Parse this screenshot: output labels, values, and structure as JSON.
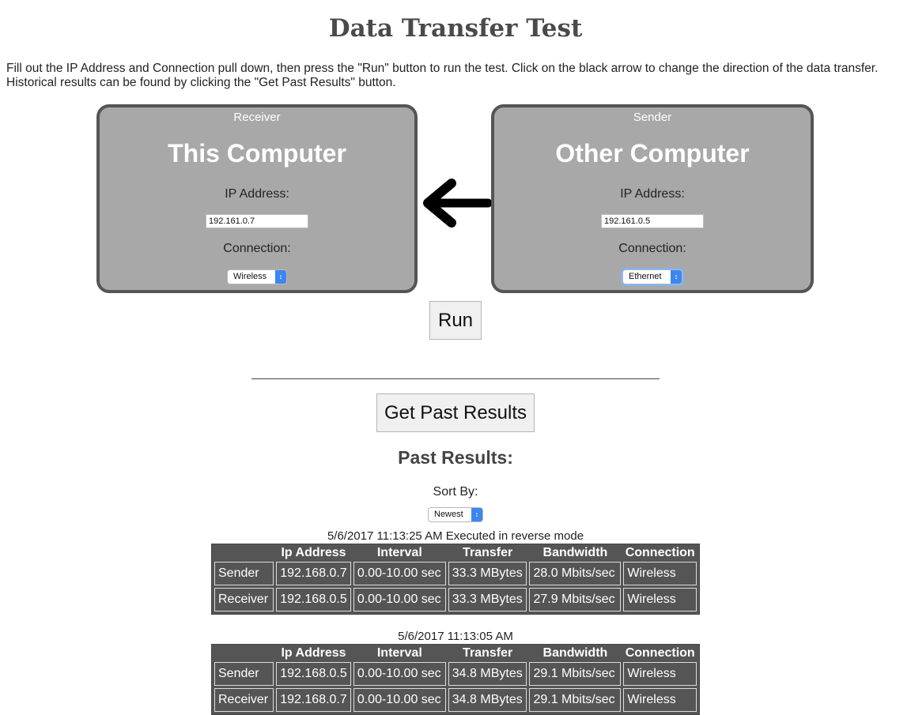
{
  "page_title": "Data Transfer Test",
  "instructions": "Fill out the IP Address and Connection pull down, then press the \"Run\" button to run the test. Click on the black arrow to change the direction of the data transfer. Historical results can be found by clicking the \"Get Past Results\" button.",
  "receiver": {
    "role": "Receiver",
    "name": "This Computer",
    "ip_label": "IP Address:",
    "ip_value": "192.161.0.7",
    "connection_label": "Connection:",
    "connection_value": "Wireless"
  },
  "sender": {
    "role": "Sender",
    "name": "Other Computer",
    "ip_label": "IP Address:",
    "ip_value": "192.161.0.5",
    "connection_label": "Connection:",
    "connection_value": "Ethernet"
  },
  "run_button": "Run",
  "past_button": "Get Past Results",
  "past_title": "Past Results:",
  "sort": {
    "label": "Sort By:",
    "value": "Newest"
  },
  "columns": [
    "",
    "Ip Address",
    "Interval",
    "Transfer",
    "Bandwidth",
    "Connection"
  ],
  "results": [
    {
      "caption": "5/6/2017 11:13:25 AM Executed in reverse mode",
      "rows": [
        [
          "Sender",
          "192.168.0.7",
          "0.00-10.00 sec",
          "33.3 MBytes",
          "28.0 Mbits/sec",
          "Wireless"
        ],
        [
          "Receiver",
          "192.168.0.5",
          "0.00-10.00 sec",
          "33.3 MBytes",
          "27.9 Mbits/sec",
          "Wireless"
        ]
      ]
    },
    {
      "caption": "5/6/2017 11:13:05 AM",
      "rows": [
        [
          "Sender",
          "192.168.0.5",
          "0.00-10.00 sec",
          "34.8 MBytes",
          "29.1 Mbits/sec",
          "Wireless"
        ],
        [
          "Receiver",
          "192.168.0.7",
          "0.00-10.00 sec",
          "34.8 MBytes",
          "29.1 Mbits/sec",
          "Wireless"
        ]
      ]
    }
  ]
}
